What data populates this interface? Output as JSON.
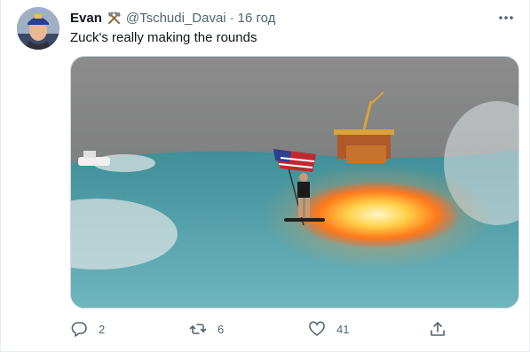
{
  "tweet": {
    "author_name": "Evan",
    "author_badge_icon": "hammer-pick-icon",
    "handle": "@Tschudi_Davai",
    "separator": "·",
    "time": "16 год",
    "text": "Zuck's really making the rounds",
    "media": {
      "description_icon": "image-icon"
    },
    "actions": {
      "reply_count": "2",
      "retweet_count": "6",
      "like_count": "41"
    }
  },
  "colors": {
    "text_primary": "#0f1419",
    "text_secondary": "#536471",
    "border": "#e6ecf0"
  }
}
